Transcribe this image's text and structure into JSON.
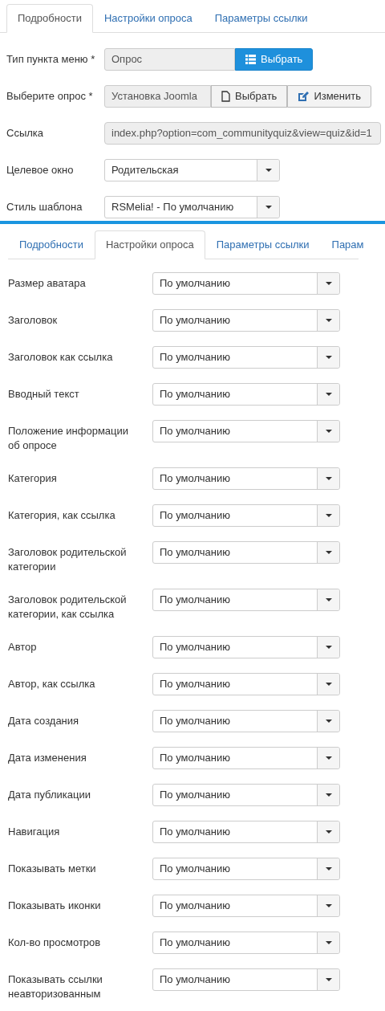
{
  "panels": [
    {
      "tabs": [
        {
          "label": "Подробности",
          "selected": true
        },
        {
          "label": "Настройки опроса",
          "selected": false
        },
        {
          "label": "Параметры ссылки",
          "selected": false
        }
      ],
      "fields": [
        {
          "label": "Тип пункта меню *",
          "kind": "chooser",
          "value": "Опрос",
          "buttons": [
            {
              "label": "Выбрать",
              "kind": "list",
              "primary": true
            }
          ]
        },
        {
          "label": "Выберите опрос *",
          "kind": "chooser",
          "value": "Установка Joomla",
          "buttons": [
            {
              "label": "Выбрать",
              "kind": "file",
              "primary": false
            },
            {
              "label": "Изменить",
              "kind": "edit",
              "primary": false
            }
          ]
        },
        {
          "label": "Ссылка",
          "kind": "readonly",
          "value": "index.php?option=com_communityquiz&view=quiz&id=1"
        },
        {
          "label": "Целевое окно",
          "kind": "select",
          "value": "Родительская"
        },
        {
          "label": "Стиль шаблона",
          "kind": "select",
          "value": "RSMelia! - По умолчанию"
        }
      ]
    },
    {
      "tabs": [
        {
          "label": "Подробности",
          "selected": false
        },
        {
          "label": "Настройки опроса",
          "selected": true
        },
        {
          "label": "Параметры ссылки",
          "selected": false
        },
        {
          "label": "Парам",
          "selected": false
        }
      ],
      "fields": [
        {
          "label": "Размер аватара",
          "kind": "select",
          "value": "По умолчанию"
        },
        {
          "label": "Заголовок",
          "kind": "select",
          "value": "По умолчанию"
        },
        {
          "label": "Заголовок как ссылка",
          "kind": "select",
          "value": "По умолчанию"
        },
        {
          "label": "Вводный текст",
          "kind": "select",
          "value": "По умолчанию"
        },
        {
          "label": "Положение информации об опросе",
          "kind": "select",
          "value": "По умолчанию"
        },
        {
          "label": "Категория",
          "kind": "select",
          "value": "По умолчанию"
        },
        {
          "label": "Категория, как ссылка",
          "kind": "select",
          "value": "По умолчанию"
        },
        {
          "label": "Заголовок родительской категории",
          "kind": "select",
          "value": "По умолчанию"
        },
        {
          "label": "Заголовок родительской категории, как ссылка",
          "kind": "select",
          "value": "По умолчанию"
        },
        {
          "label": "Автор",
          "kind": "select",
          "value": "По умолчанию"
        },
        {
          "label": "Автор, как ссылка",
          "kind": "select",
          "value": "По умолчанию"
        },
        {
          "label": "Дата создания",
          "kind": "select",
          "value": "По умолчанию"
        },
        {
          "label": "Дата изменения",
          "kind": "select",
          "value": "По умолчанию"
        },
        {
          "label": "Дата публикации",
          "kind": "select",
          "value": "По умолчанию"
        },
        {
          "label": "Навигация",
          "kind": "select",
          "value": "По умолчанию"
        },
        {
          "label": "Показывать метки",
          "kind": "select",
          "value": "По умолчанию"
        },
        {
          "label": "Показывать иконки",
          "kind": "select",
          "value": "По умолчанию"
        },
        {
          "label": "Кол-во просмотров",
          "kind": "select",
          "value": "По умолчанию"
        },
        {
          "label": "Показывать ссылки неавторизованным",
          "kind": "select",
          "value": "По умолчанию"
        }
      ]
    }
  ]
}
